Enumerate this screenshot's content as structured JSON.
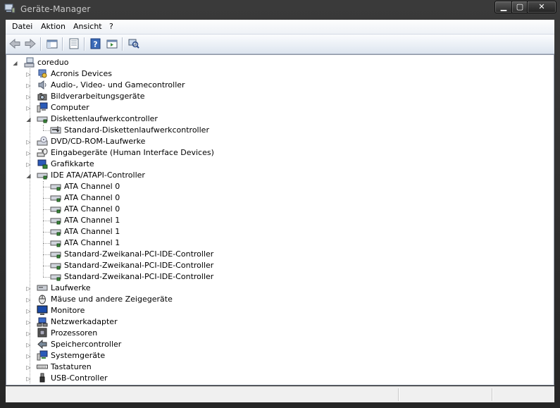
{
  "window": {
    "title": "Geräte-Manager"
  },
  "menubar": {
    "items": [
      "Datei",
      "Aktion",
      "Ansicht",
      "?"
    ]
  },
  "toolbar": {
    "buttons": [
      "back-icon",
      "forward-icon",
      "console-tree-icon",
      "properties-icon",
      "help-icon",
      "show-hide-icon",
      "scan-hardware-icon"
    ]
  },
  "tree": {
    "root": "coreduo",
    "categories": [
      {
        "label": "Acronis Devices",
        "icon": "acronis-icon",
        "expanded": false
      },
      {
        "label": "Audio-, Video- und Gamecontroller",
        "icon": "speaker-icon",
        "expanded": false
      },
      {
        "label": "Bildverarbeitungsgeräte",
        "icon": "camera-icon",
        "expanded": false
      },
      {
        "label": "Computer",
        "icon": "computer-icon",
        "expanded": false
      },
      {
        "label": "Diskettenlaufwerkcontroller",
        "icon": "floppy-controller-icon",
        "expanded": true,
        "children": [
          "Standard-Diskettenlaufwerkcontroller"
        ]
      },
      {
        "label": "DVD/CD-ROM-Laufwerke",
        "icon": "dvd-icon",
        "expanded": false
      },
      {
        "label": "Eingabegeräte (Human Interface Devices)",
        "icon": "hid-icon",
        "expanded": false
      },
      {
        "label": "Grafikkarte",
        "icon": "display-adapter-icon",
        "expanded": false
      },
      {
        "label": "IDE ATA/ATAPI-Controller",
        "icon": "ide-controller-icon",
        "expanded": true,
        "children": [
          "ATA Channel 0",
          "ATA Channel 0",
          "ATA Channel 0",
          "ATA Channel 1",
          "ATA Channel 1",
          "ATA Channel 1",
          "Standard-Zweikanal-PCI-IDE-Controller",
          "Standard-Zweikanal-PCI-IDE-Controller",
          "Standard-Zweikanal-PCI-IDE-Controller"
        ]
      },
      {
        "label": "Laufwerke",
        "icon": "disk-drive-icon",
        "expanded": false
      },
      {
        "label": "Mäuse und andere Zeigegeräte",
        "icon": "mouse-icon",
        "expanded": false
      },
      {
        "label": "Monitore",
        "icon": "monitor-icon",
        "expanded": false
      },
      {
        "label": "Netzwerkadapter",
        "icon": "network-adapter-icon",
        "expanded": false
      },
      {
        "label": "Prozessoren",
        "icon": "processor-icon",
        "expanded": false
      },
      {
        "label": "Speichercontroller",
        "icon": "storage-controller-icon",
        "expanded": false
      },
      {
        "label": "Systemgeräte",
        "icon": "system-devices-icon",
        "expanded": false
      },
      {
        "label": "Tastaturen",
        "icon": "keyboard-icon",
        "expanded": false
      },
      {
        "label": "USB-Controller",
        "icon": "usb-icon",
        "expanded": false
      }
    ]
  }
}
